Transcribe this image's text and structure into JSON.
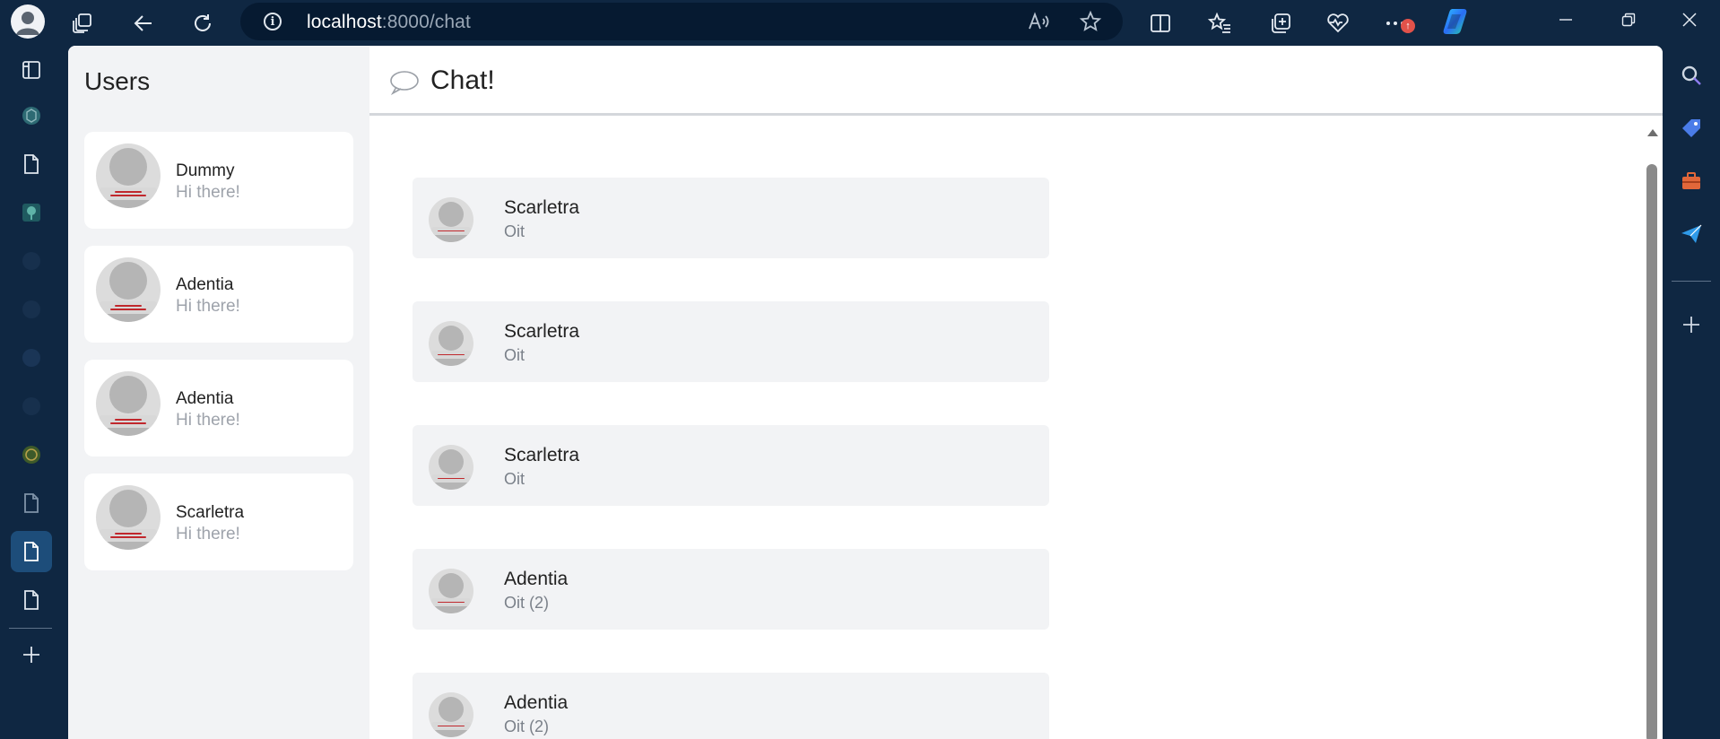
{
  "browser": {
    "url_host": "localhost",
    "url_path": ":8000/chat",
    "notification_badge": "↑",
    "icons": [
      "profile-icon",
      "workspaces-icon",
      "back-icon",
      "refresh-icon",
      "site-info-icon",
      "read-aloud-icon",
      "favorite-star-icon",
      "split-screen-icon",
      "favorites-icon",
      "collections-icon",
      "browser-essentials-icon",
      "more-icon",
      "copilot-icon",
      "minimize-icon",
      "restore-icon",
      "close-icon"
    ]
  },
  "vertical_tabs": [
    "tab-actions-icon",
    "chatgpt-icon",
    "document-icon",
    "tree-icon",
    "github-icon",
    "github-icon",
    "github-icon",
    "github-icon",
    "emblem-icon",
    "document-icon",
    "document-icon",
    "document-icon",
    "new-tab-icon"
  ],
  "right_sidebar": [
    "search-icon",
    "shopping-icon",
    "tools-icon",
    "send-icon",
    "add-icon"
  ],
  "users_panel": {
    "title": "Users",
    "users": [
      {
        "name": "Dummy",
        "message": "Hi there!"
      },
      {
        "name": "Adentia",
        "message": "Hi there!"
      },
      {
        "name": "Adentia",
        "message": "Hi there!"
      },
      {
        "name": "Scarletra",
        "message": "Hi there!"
      }
    ]
  },
  "chat": {
    "title": "Chat!",
    "messages": [
      {
        "author": "Scarletra",
        "text": "Oit"
      },
      {
        "author": "Scarletra",
        "text": "Oit"
      },
      {
        "author": "Scarletra",
        "text": "Oit"
      },
      {
        "author": "Adentia",
        "text": "Oit (2)"
      },
      {
        "author": "Adentia",
        "text": "Oit (2)"
      }
    ]
  },
  "colors": {
    "browser_frame": "#0f2742",
    "address_bar": "#061a31",
    "panel_bg": "#f2f3f5",
    "active_tab": "#1d4d7a",
    "avatar_band_text": "#c0282d"
  }
}
